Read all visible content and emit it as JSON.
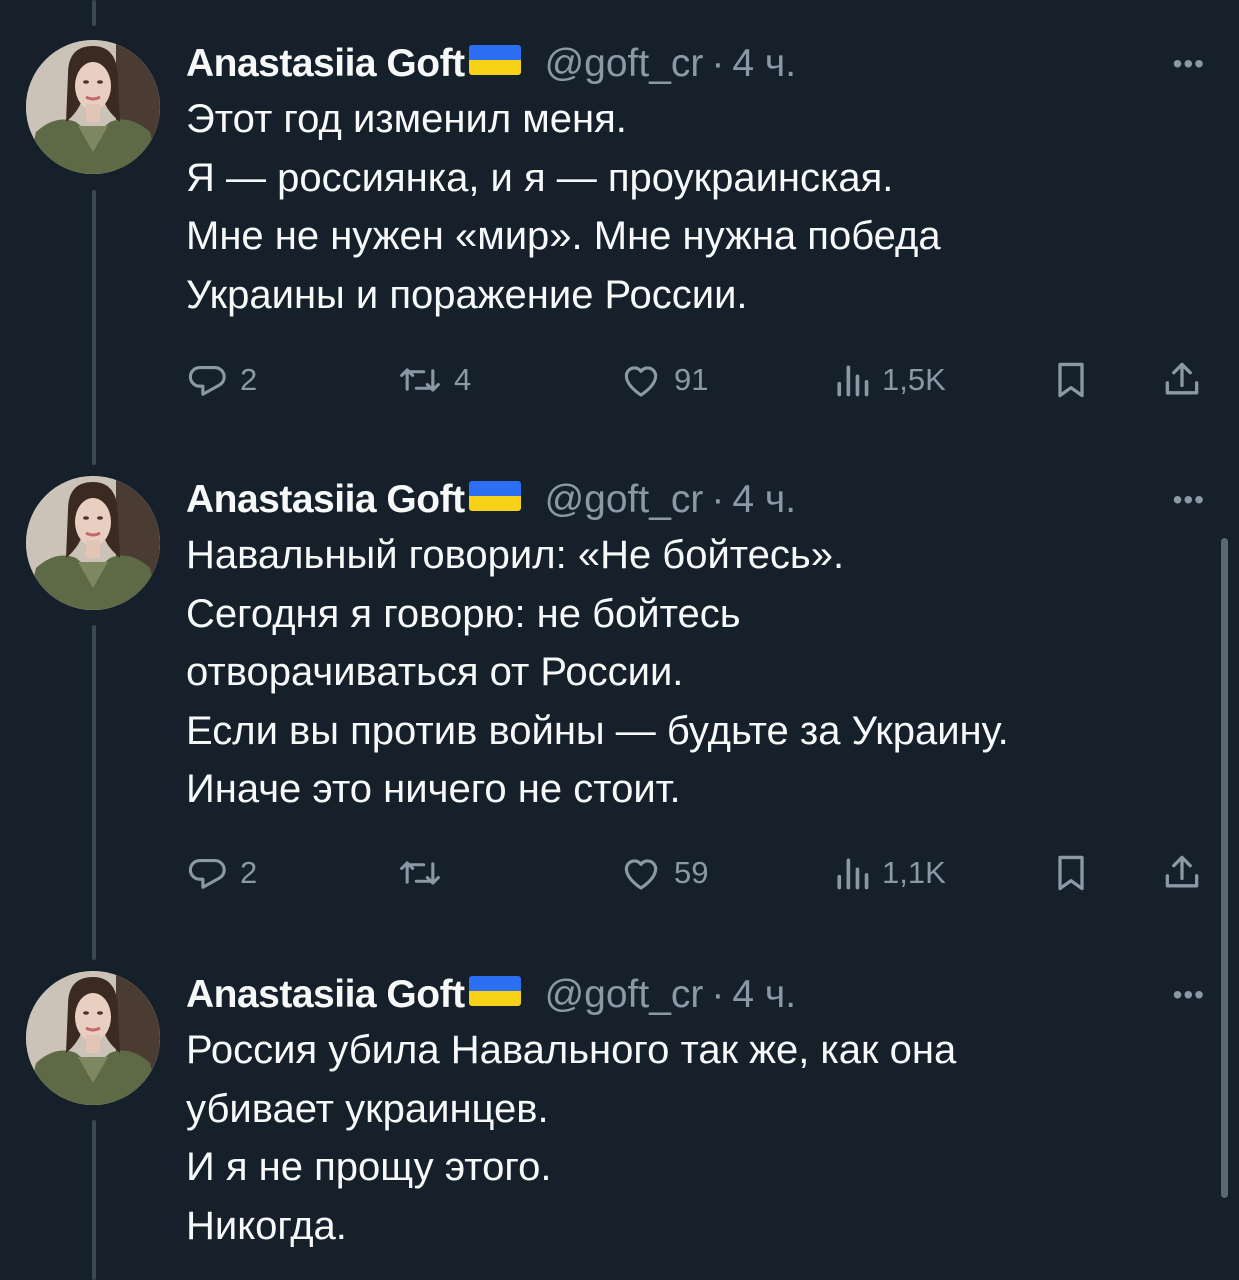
{
  "tweets": [
    {
      "author": {
        "name": "Anastasiia Goft",
        "flag": "ukraine-flag",
        "handle": "@goft_cr",
        "time": "4 ч."
      },
      "lines": [
        "Этот год изменил меня.",
        "Я — россиянка, и я — проукраинская.",
        "Мне не нужен «мир». Мне нужна победа",
        "Украины и поражение России."
      ],
      "actions": {
        "replies": "2",
        "reposts": "4",
        "likes": "91",
        "views": "1,5K"
      }
    },
    {
      "author": {
        "name": "Anastasiia Goft",
        "flag": "ukraine-flag",
        "handle": "@goft_cr",
        "time": "4 ч."
      },
      "lines": [
        "Навальный говорил: «Не бойтесь».",
        "Сегодня я говорю: не бойтесь",
        "отворачиваться от России.",
        "Если вы против войны — будьте за Украину.",
        "Иначе это ничего не стоит."
      ],
      "actions": {
        "replies": "2",
        "reposts": "",
        "likes": "59",
        "views": "1,1K"
      }
    },
    {
      "author": {
        "name": "Anastasiia Goft",
        "flag": "ukraine-flag",
        "handle": "@goft_cr",
        "time": "4 ч."
      },
      "lines": [
        "Россия убила Навального так же, как она",
        "убивает украинцев.",
        "И я не прощу этого.",
        "Никогда."
      ]
    }
  ],
  "common": {
    "dot": "·",
    "more": "•••"
  },
  "icons": {
    "reply": "reply-icon",
    "repost": "repost-icon",
    "like": "heart-icon",
    "views": "views-icon",
    "bookmark": "bookmark-icon",
    "share": "share-icon",
    "more": "more-icon"
  },
  "colors": {
    "background": "#15202b",
    "text": "#f7f9f9",
    "secondary": "#8b98a5",
    "thread_line": "#3b4753"
  }
}
